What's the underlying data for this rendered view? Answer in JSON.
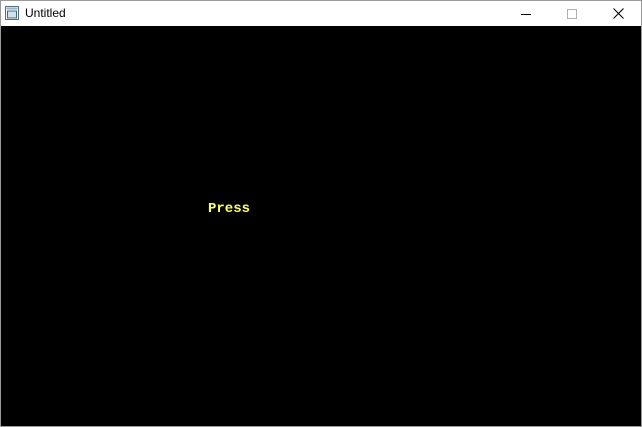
{
  "window": {
    "title": "Untitled",
    "icon": "app-window-icon",
    "controls": {
      "minimize_icon": "minimize-icon",
      "maximize_icon": "maximize-icon",
      "close_icon": "close-icon"
    }
  },
  "canvas": {
    "background": "#000000",
    "text": "Press",
    "text_color": "#ffff66"
  }
}
